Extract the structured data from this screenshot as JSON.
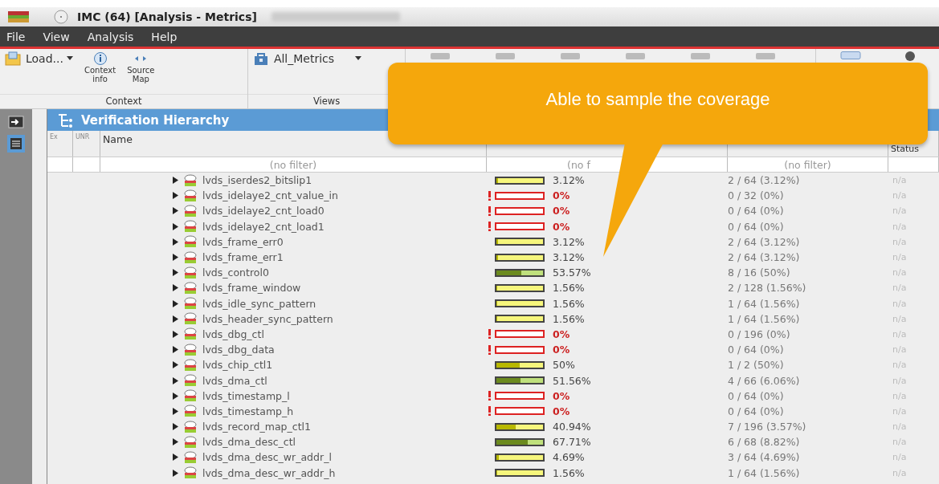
{
  "window": {
    "title": "IMC (64) [Analysis - Metrics]"
  },
  "menu": [
    "File",
    "View",
    "Analysis",
    "Help"
  ],
  "toolbar": {
    "load": "Load...",
    "context_info": [
      "Context",
      "info"
    ],
    "source_map": [
      "Source",
      "Map"
    ],
    "view_select": "All_Metrics",
    "groups": [
      "Context",
      "Views"
    ]
  },
  "panel": {
    "title": "Verification Hierarchy"
  },
  "table": {
    "columns": [
      "Ex",
      "UNR",
      "Name",
      "Status"
    ],
    "filters": [
      "(no filter)",
      "(no f",
      "(no filter)"
    ],
    "rows": [
      {
        "name": "lvds_iserdes2_bitslip1",
        "expanded": false,
        "level": 0.0312,
        "average": "3.12%",
        "covered": "2 / 64 (3.12%)",
        "status": "n/a"
      },
      {
        "name": "lvds_idelaye2_cnt_value_in",
        "expanded": false,
        "level": 0,
        "average": "0%",
        "covered": "0 / 32 (0%)",
        "status": "n/a"
      },
      {
        "name": "lvds_idelaye2_cnt_load0",
        "expanded": false,
        "level": 0,
        "average": "0%",
        "covered": "0 / 64 (0%)",
        "status": "n/a"
      },
      {
        "name": "lvds_idelaye2_cnt_load1",
        "expanded": false,
        "level": 0,
        "average": "0%",
        "covered": "0 / 64 (0%)",
        "status": "n/a"
      },
      {
        "name": "lvds_frame_err0",
        "expanded": false,
        "level": 0.0312,
        "average": "3.12%",
        "covered": "2 / 64 (3.12%)",
        "status": "n/a"
      },
      {
        "name": "lvds_frame_err1",
        "expanded": false,
        "level": 0.0312,
        "average": "3.12%",
        "covered": "2 / 64 (3.12%)",
        "status": "n/a"
      },
      {
        "name": "lvds_control0",
        "expanded": false,
        "level": 0.5357,
        "average": "53.57%",
        "covered": "8 / 16 (50%)",
        "status": "n/a"
      },
      {
        "name": "lvds_frame_window",
        "expanded": false,
        "level": 0.0156,
        "average": "1.56%",
        "covered": "2 / 128 (1.56%)",
        "status": "n/a"
      },
      {
        "name": "lvds_idle_sync_pattern",
        "expanded": false,
        "level": 0.0156,
        "average": "1.56%",
        "covered": "1 / 64 (1.56%)",
        "status": "n/a"
      },
      {
        "name": "lvds_header_sync_pattern",
        "expanded": false,
        "level": 0.0156,
        "average": "1.56%",
        "covered": "1 / 64 (1.56%)",
        "status": "n/a"
      },
      {
        "name": "lvds_dbg_ctl",
        "expanded": false,
        "level": 0,
        "average": "0%",
        "covered": "0 / 196 (0%)",
        "status": "n/a"
      },
      {
        "name": "lvds_dbg_data",
        "expanded": false,
        "level": 0,
        "average": "0%",
        "covered": "0 / 64 (0%)",
        "status": "n/a"
      },
      {
        "name": "lvds_chip_ctl1",
        "expanded": false,
        "level": 0.5,
        "average": "50%",
        "covered": "1 / 2 (50%)",
        "status": "n/a"
      },
      {
        "name": "lvds_dma_ctl",
        "expanded": false,
        "level": 0.5156,
        "average": "51.56%",
        "covered": "4 / 66 (6.06%)",
        "status": "n/a"
      },
      {
        "name": "lvds_timestamp_l",
        "expanded": false,
        "level": 0,
        "average": "0%",
        "covered": "0 / 64 (0%)",
        "status": "n/a"
      },
      {
        "name": "lvds_timestamp_h",
        "expanded": false,
        "level": 0,
        "average": "0%",
        "covered": "0 / 64 (0%)",
        "status": "n/a"
      },
      {
        "name": "lvds_record_map_ctl1",
        "expanded": false,
        "level": 0.4094,
        "average": "40.94%",
        "covered": "7 / 196 (3.57%)",
        "status": "n/a"
      },
      {
        "name": "lvds_dma_desc_ctl",
        "expanded": false,
        "level": 0.6771,
        "average": "67.71%",
        "covered": "6 / 68 (8.82%)",
        "status": "n/a"
      },
      {
        "name": "lvds_dma_desc_wr_addr_l",
        "expanded": false,
        "level": 0.0469,
        "average": "4.69%",
        "covered": "3 / 64 (4.69%)",
        "status": "n/a"
      },
      {
        "name": "lvds_dma_desc_wr_addr_h",
        "expanded": false,
        "level": 0.0156,
        "average": "1.56%",
        "covered": "1 / 64 (1.56%)",
        "status": "n/a"
      }
    ]
  },
  "callout": {
    "text": "Able to sample the coverage"
  }
}
